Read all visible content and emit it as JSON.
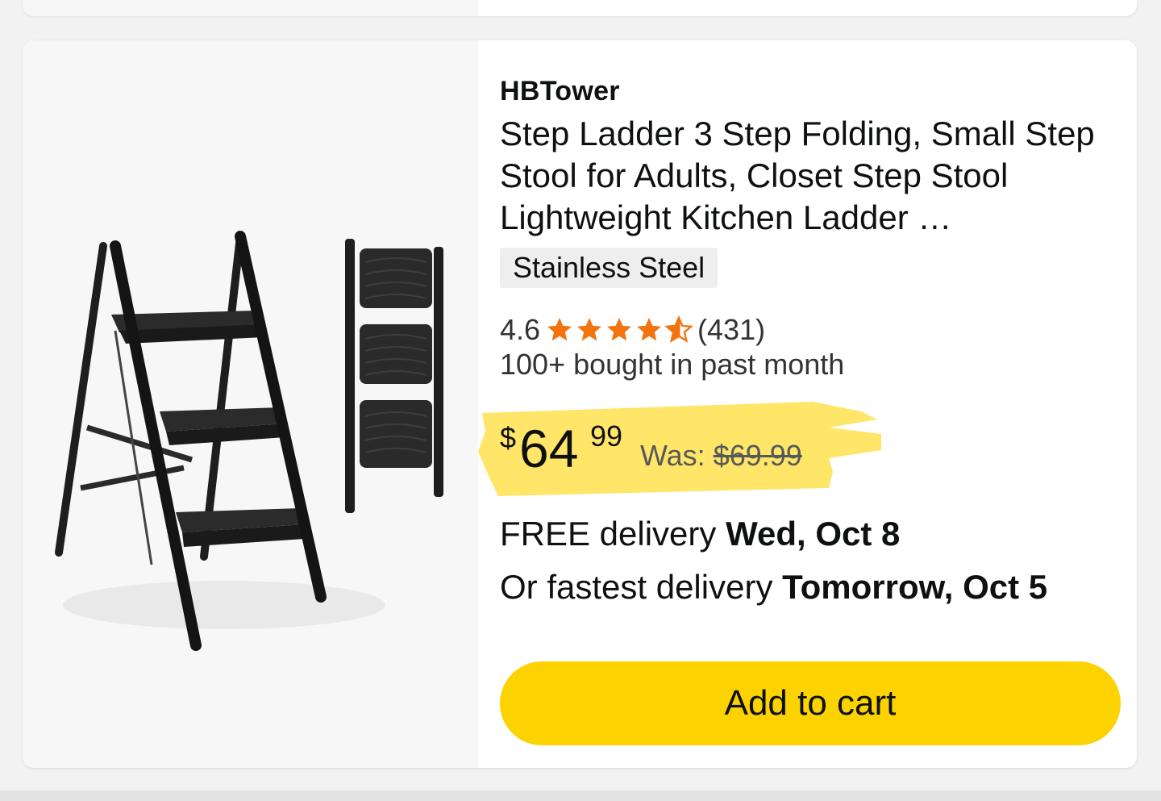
{
  "product": {
    "brand": "HBTower",
    "title": "Step Ladder 3 Step Folding, Small Step Stool for Adults, Closet Step Stool Lightweight Kitchen Ladder …",
    "variant": "Stainless Steel",
    "rating": "4.6",
    "rating_value": 4.6,
    "rating_count": "(431)",
    "bought_text": "100+ bought in past month",
    "price": {
      "currency": "$",
      "whole": "64",
      "fraction": "99",
      "was_label": "Was:",
      "was_price": "$69.99"
    },
    "delivery": {
      "free_prefix": "FREE delivery ",
      "free_date": "Wed, Oct 8",
      "fast_prefix": "Or fastest delivery ",
      "fast_date": "Tomorrow, Oct 5"
    },
    "add_to_cart_label": "Add to cart"
  },
  "colors": {
    "star": "#f3730f",
    "button": "#fcd200",
    "highlight": "#ffe14d",
    "text": "#0f1111"
  },
  "icons": {
    "star_full": "star-full-icon",
    "star_partial": "star-half-icon"
  }
}
